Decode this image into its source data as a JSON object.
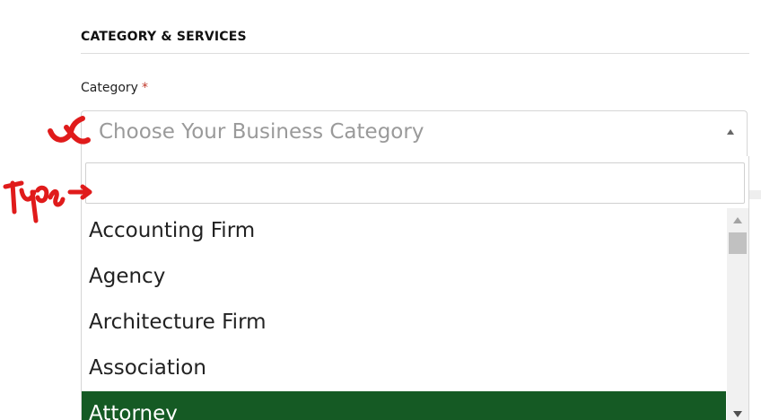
{
  "section": {
    "title": "CATEGORY & SERVICES"
  },
  "field": {
    "label": "Category",
    "required_mark": "*"
  },
  "select": {
    "placeholder": "Choose Your Business Category"
  },
  "dropdown": {
    "search_value": "",
    "options": [
      {
        "label": "Accounting Firm"
      },
      {
        "label": "Agency"
      },
      {
        "label": "Architecture Firm"
      },
      {
        "label": "Association"
      },
      {
        "label": "Attorney",
        "highlighted": true
      }
    ],
    "highlight_color": "#155a24"
  },
  "annotations": {
    "color": "#e01b1b",
    "marks": [
      "handwritten-check-mark",
      "handwritten-arrow"
    ]
  }
}
